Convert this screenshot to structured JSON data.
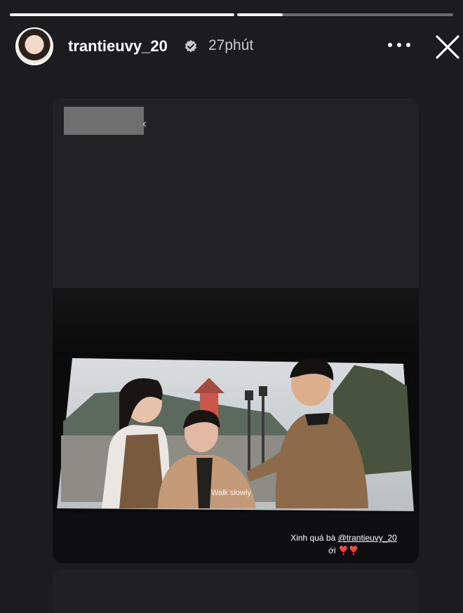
{
  "story": {
    "progress_bars": [
      {
        "fill": 1.0
      },
      {
        "fill": 0.2
      }
    ],
    "author": {
      "username": "trantieuvy_20",
      "time_ago": "27phút",
      "verified": true
    },
    "actions": {
      "more_icon": "more-horizontal-icon",
      "close_icon": "close-icon"
    }
  },
  "repost": {
    "photo": {
      "subtitle": "Walk slowly",
      "caption_text": "Xinh quá bà ",
      "caption_mention": "@trantieuvy_20",
      "caption_line2": "ới ",
      "caption_hearts": "❣️❣️"
    }
  },
  "colors": {
    "background": "#1c1c1e",
    "card": "#232326",
    "accent_heart": "#e5484d"
  }
}
